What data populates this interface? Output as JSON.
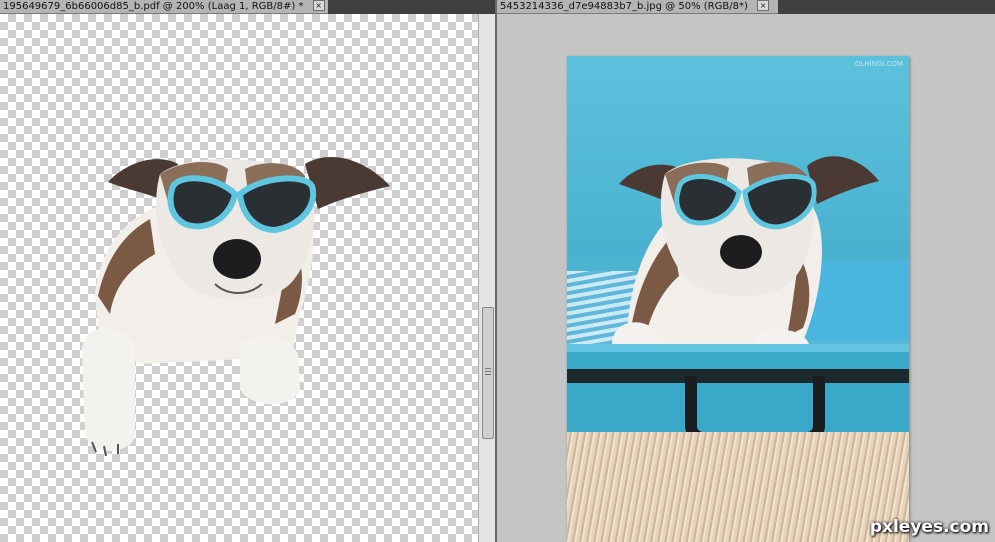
{
  "left_document": {
    "tab_title": "195649679_6b66006d85_b.pdf @ 200% (Laag 1, RGB/8#) *",
    "close_label": "×"
  },
  "right_document": {
    "tab_title": "5453214336_d7e94883b7_b.jpg @ 50% (RGB/8*)",
    "close_label": "×",
    "photo_watermark": "OLHINGI.COM"
  },
  "site_watermark": "pxleyes.com",
  "colors": {
    "glasses": "#5fc6e0",
    "background_blue": "#4ab2d0",
    "workspace_gray": "#c5c5c5"
  }
}
